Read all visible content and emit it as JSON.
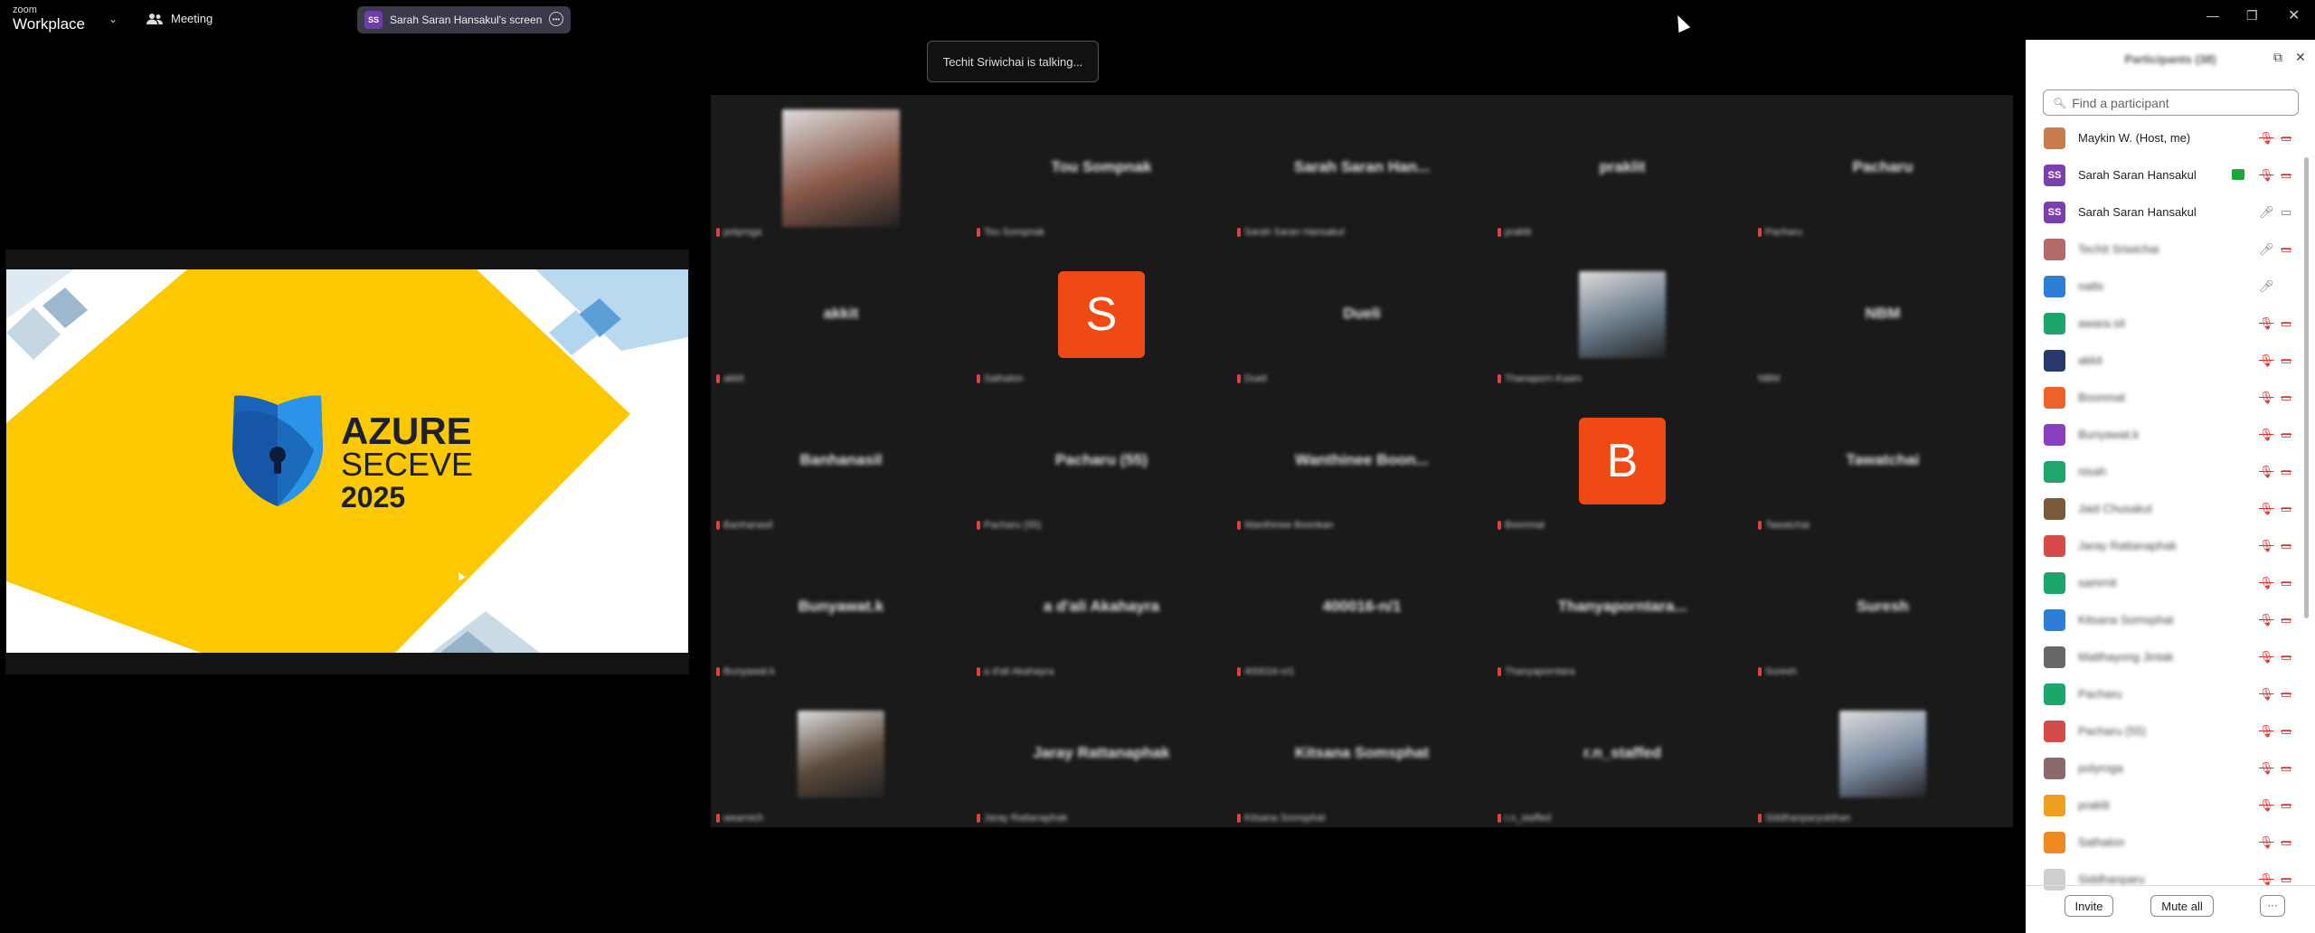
{
  "app": {
    "logo_top": "zoom",
    "logo_bottom": "Workplace"
  },
  "topbar": {
    "meeting_label": "Meeting",
    "share_indicator": {
      "initials": "SS",
      "label": "Sarah Saran Hansakul's screen"
    }
  },
  "talking_toast": "Techit Sriwichai is talking...",
  "slide": {
    "title_line1": "AZURE",
    "title_line2": "SECEVE",
    "title_line3": "2025"
  },
  "gallery": {
    "tiles": [
      {
        "name": "",
        "label": "polyroga",
        "photo": true
      },
      {
        "name": "Tou Sompnak",
        "label": "Tou Sompnak"
      },
      {
        "name": "Sarah Saran Han...",
        "label": "Sarah Saran Hansakul"
      },
      {
        "name": "praklit",
        "label": "praklit"
      },
      {
        "name": "Pacharu",
        "label": "Pacharu"
      },
      {
        "name": "akkit",
        "label": "akkit"
      },
      {
        "name": "",
        "label": "Sathalon",
        "avatar": "S"
      },
      {
        "name": "Dueli",
        "label": "Dueli"
      },
      {
        "name": "",
        "label": "Thanaporn Kaam",
        "photo": true
      },
      {
        "name": "NBM",
        "label": "NBM"
      },
      {
        "name": "Banhanasil",
        "label": "Banhanasil"
      },
      {
        "name": "Pacharu (55)",
        "label": "Pacharu (55)"
      },
      {
        "name": "Wanthinee Boon...",
        "label": "Wanthinee Boonkan"
      },
      {
        "name": "",
        "label": "Boonmat",
        "avatar": "B"
      },
      {
        "name": "Tawatchai",
        "label": "Tawatchai"
      },
      {
        "name": "Bunyawat.k",
        "label": "Bunyawat.k"
      },
      {
        "name": "a d'ali Akahayra",
        "label": "a d'ali Akahayra"
      },
      {
        "name": "400016-n/1",
        "label": "400016-n/1"
      },
      {
        "name": "Thanyaporntara...",
        "label": "Thanyaporntara"
      },
      {
        "name": "Suresh",
        "label": "Suresh"
      },
      {
        "name": "",
        "label": "wearnich",
        "photo": true
      },
      {
        "name": "Jaray Rattanaphak",
        "label": "Jaray Rattanaphak"
      },
      {
        "name": "Kitsana Somsphat",
        "label": "Kitsana Somsphat"
      },
      {
        "name": "r.n_staffed",
        "label": "r.n_staffed"
      },
      {
        "name": "",
        "label": "Siddhanparyukthan",
        "photo": true
      }
    ]
  },
  "panel": {
    "title": "Participants (38)",
    "search_placeholder": "Find a participant",
    "participants": [
      {
        "name": "Maykin W. (Host, me)",
        "color": "#c97b4d",
        "init": "",
        "blur": false,
        "mic": "muted",
        "cam": "off"
      },
      {
        "name": "Sarah Saran Hansakul",
        "color": "#7b3fb0",
        "init": "SS",
        "blur": false,
        "mic": "muted",
        "cam": "off",
        "sharing": true
      },
      {
        "name": "Sarah Saran Hansakul",
        "color": "#7b3fb0",
        "init": "SS",
        "blur": false,
        "mic": "on",
        "cam": "on"
      },
      {
        "name": "Techit Sriwichai",
        "color": "#b56a6a",
        "init": "",
        "blur": true,
        "mic": "on",
        "cam": "off"
      },
      {
        "name": "natts",
        "color": "#2d7fd6",
        "init": "",
        "blur": true,
        "mic": "on",
        "cam": "none"
      },
      {
        "name": "awara.sit",
        "color": "#1ca66b",
        "init": "",
        "blur": true,
        "mic": "muted",
        "cam": "off"
      },
      {
        "name": "akkit",
        "color": "#253a6b",
        "init": "",
        "blur": true,
        "mic": "muted",
        "cam": "off"
      },
      {
        "name": "Boonmat",
        "color": "#f0622a",
        "init": "",
        "blur": true,
        "mic": "muted",
        "cam": "off"
      },
      {
        "name": "Bunyawat.k",
        "color": "#8a3fc0",
        "init": "",
        "blur": true,
        "mic": "muted",
        "cam": "off"
      },
      {
        "name": "nisah",
        "color": "#20a56a",
        "init": "",
        "blur": true,
        "mic": "muted",
        "cam": "off"
      },
      {
        "name": "Jaid Chusakul",
        "color": "#7a5a3a",
        "init": "",
        "blur": true,
        "mic": "muted",
        "cam": "off"
      },
      {
        "name": "Jaray Rattanaphak",
        "color": "#d64a4a",
        "init": "",
        "blur": true,
        "mic": "muted",
        "cam": "off"
      },
      {
        "name": "samrnit",
        "color": "#1ca66b",
        "init": "",
        "blur": true,
        "mic": "muted",
        "cam": "off"
      },
      {
        "name": "Kitsana Somsphat",
        "color": "#2d7fd6",
        "init": "",
        "blur": true,
        "mic": "muted",
        "cam": "off"
      },
      {
        "name": "Matthayong Jintak",
        "color": "#666",
        "init": "",
        "blur": true,
        "mic": "muted",
        "cam": "off"
      },
      {
        "name": "Pacharu",
        "color": "#1ca66b",
        "init": "",
        "blur": true,
        "mic": "muted",
        "cam": "off"
      },
      {
        "name": "Pacharu (55)",
        "color": "#d64a4a",
        "init": "",
        "blur": true,
        "mic": "muted",
        "cam": "off"
      },
      {
        "name": "polyroga",
        "color": "#8a6a6a",
        "init": "",
        "blur": true,
        "mic": "muted",
        "cam": "off"
      },
      {
        "name": "praklit",
        "color": "#f0a020",
        "init": "",
        "blur": true,
        "mic": "muted",
        "cam": "off"
      },
      {
        "name": "Sathalon",
        "color": "#f08a20",
        "init": "",
        "blur": true,
        "mic": "muted",
        "cam": "off"
      },
      {
        "name": "Siddhanparu",
        "color": "#cfcfcf",
        "init": "",
        "blur": true,
        "mic": "muted",
        "cam": "off"
      }
    ],
    "invite_label": "Invite",
    "mute_all_label": "Mute all",
    "more_label": "···"
  }
}
